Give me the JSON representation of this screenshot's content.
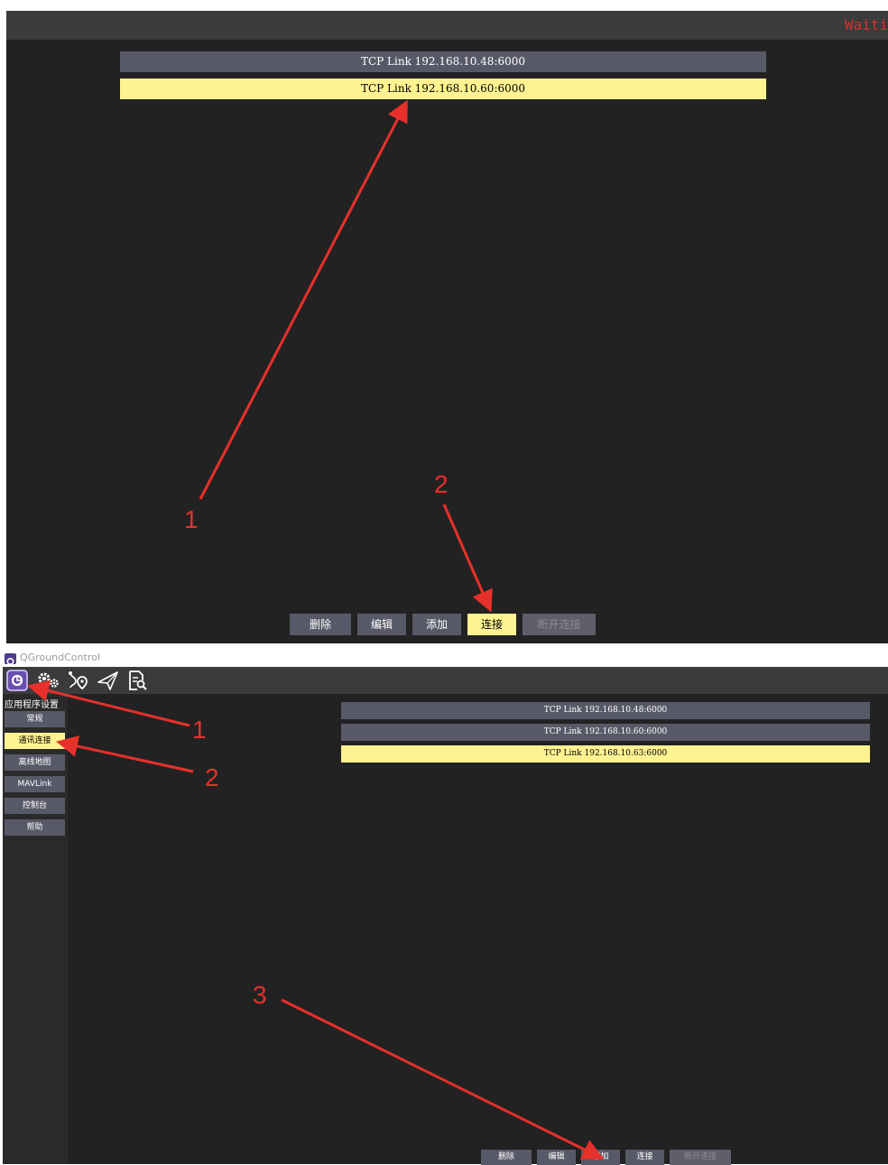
{
  "top_panel": {
    "status_text": "Waiti",
    "links": [
      {
        "label": "TCP Link 192.168.10.48:6000",
        "selected": false
      },
      {
        "label": "TCP Link 192.168.10.60:6000",
        "selected": true
      }
    ],
    "buttons": {
      "delete": "删除",
      "edit": "编辑",
      "add": "添加",
      "connect": "连接",
      "disconnect": "断开连接"
    },
    "annotations": [
      "1",
      "2"
    ]
  },
  "bottom_window": {
    "title": "QGroundControl",
    "toolbar_icons": [
      "qgc-logo-icon",
      "gears-icon",
      "plan-route-icon",
      "fly-paper-plane-icon",
      "analyze-document-icon"
    ],
    "sidebar": {
      "title": "应用程序设置",
      "items": [
        {
          "label": "常规",
          "selected": false
        },
        {
          "label": "通讯连接",
          "selected": true
        },
        {
          "label": "离线地图",
          "selected": false
        },
        {
          "label": "MAVLink",
          "selected": false
        },
        {
          "label": "控制台",
          "selected": false
        },
        {
          "label": "帮助",
          "selected": false
        }
      ]
    },
    "links": [
      {
        "label": "TCP Link 192.168.10.48:6000",
        "selected": false
      },
      {
        "label": "TCP Link 192.168.10.60:6000",
        "selected": false
      },
      {
        "label": "TCP Link 192.168.10.63:6000",
        "selected": true
      }
    ],
    "buttons": {
      "delete": "删除",
      "edit": "编辑",
      "add": "添加",
      "connect": "连接",
      "disconnect": "断开连接"
    },
    "annotations": [
      "1",
      "2",
      "3"
    ]
  },
  "colors": {
    "background": "#222222",
    "toolbar": "#3b3b3b",
    "button": "#585968",
    "selected": "#fff291",
    "annotation_red": "#e8302b",
    "brand_purple": "#4d3b8c"
  }
}
